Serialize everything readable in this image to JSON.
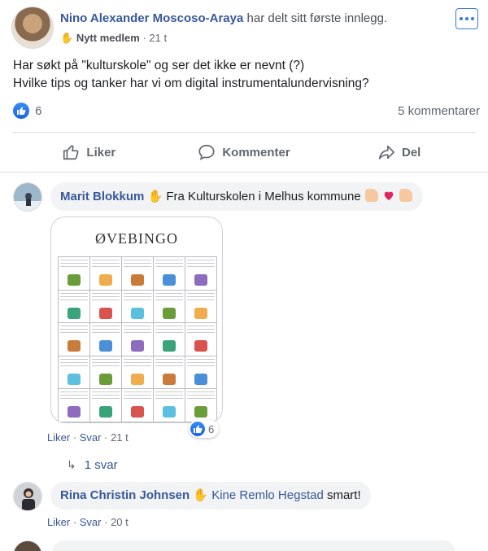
{
  "post": {
    "author": "Nino Alexander Moscoso-Araya",
    "action": "har delt sitt første innlegg.",
    "badge": "Nytt medlem",
    "time": "21 t",
    "text_lines": [
      "Har søkt på \"kulturskole\" og ser det ikke er nevnt (?)",
      "Hvilke tips og tanker har vi om digital instrumentalundervisning?"
    ],
    "reaction_count": "6",
    "comment_count": "5 kommentarer"
  },
  "actions": {
    "like": "Liker",
    "comment": "Kommenter",
    "share": "Del"
  },
  "comments": [
    {
      "name": "Marit Blokkum",
      "text": "Fra Kulturskolen i Melhus kommune",
      "image_title": "ØVEBINGO",
      "image_reactions": "6",
      "like": "Liker",
      "reply": "Svar",
      "time": "21 t",
      "replies": "1 svar"
    },
    {
      "name": "Rina Christin Johnsen",
      "mention": "Kine Remlo Hegstad",
      "text": "smart!",
      "like": "Liker",
      "reply": "Svar",
      "time": "20 t"
    }
  ],
  "colors": {
    "link": "#385898",
    "accent": "#1877f2",
    "bubble": "#f2f3f5",
    "meta": "#606770"
  },
  "icons": [
    "more-icon",
    "wave-icon",
    "like-icon",
    "comment-icon",
    "share-icon",
    "heart-icon",
    "reply-arrow-icon"
  ]
}
